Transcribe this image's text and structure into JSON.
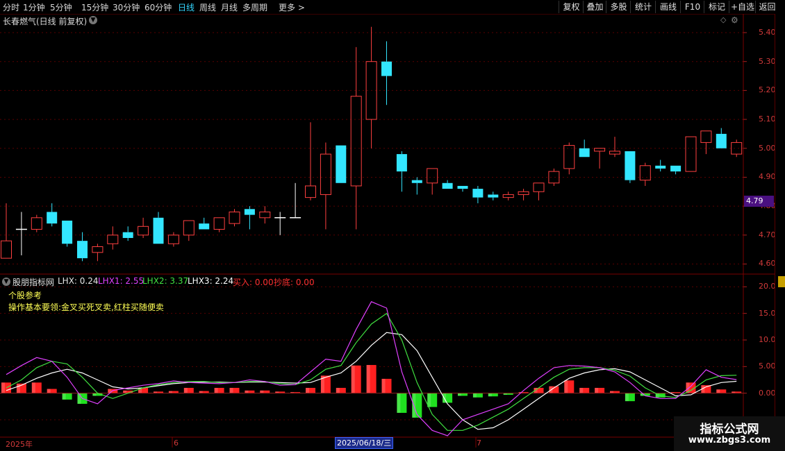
{
  "toolbar": {
    "periods": [
      "分时",
      "1分钟",
      "5分钟",
      "15分钟",
      "30分钟",
      "60分钟",
      "日线",
      "周线",
      "月线",
      "多周期",
      "更多 >"
    ],
    "active_period": "日线",
    "right_buttons": [
      "复权",
      "叠加",
      "多股",
      "统计",
      "画线",
      "F10",
      "标记",
      "+自选",
      "返回"
    ]
  },
  "main_panel": {
    "title": "长春燃气(日线 前复权)",
    "price_marker": "4.79",
    "y_labels": [
      "5.40",
      "5.30",
      "5.20",
      "5.10",
      "5.00",
      "4.90",
      "4.80",
      "4.70",
      "4.60"
    ]
  },
  "indicator_panel": {
    "name": "股朋指标网",
    "readouts": [
      {
        "text": "LHX: 0.24",
        "color": "#e6e6e6"
      },
      {
        "text": "LHX1: 2.55",
        "color": "#e040ff"
      },
      {
        "text": "LHX2: 3.37",
        "color": "#40e040"
      },
      {
        "text": "LHX3: 2.24",
        "color": "#ffffff"
      },
      {
        "text": "买入: 0.00",
        "color": "#ff3030"
      },
      {
        "text": "抄底: 0.00",
        "color": "#ff3030"
      }
    ],
    "note1": "个股参考",
    "note2": "操作基本要领:金叉买死叉卖,红柱买随便卖",
    "y_labels": [
      "20.00",
      "15.00",
      "10.00",
      "5.00",
      "0.00",
      "-5.00"
    ]
  },
  "x_axis": {
    "labels": [
      "2025年",
      "6",
      "7"
    ],
    "cursor_date": "2025/06/18/三"
  },
  "watermark": {
    "title": "指标公式网",
    "url": "www.zbgs3.com"
  },
  "colors": {
    "up": "#ff4040",
    "down": "#33e6ff",
    "grid": "#5a0000",
    "lhx1": "#e040ff",
    "lhx2": "#40e040",
    "lhx3": "#ffffff"
  },
  "chart_data": {
    "type": "candlestick",
    "ylim": [
      4.57,
      5.46
    ],
    "candles": [
      {
        "o": 4.62,
        "h": 4.81,
        "l": 4.62,
        "c": 4.68
      },
      {
        "o": 4.72,
        "h": 4.78,
        "l": 4.63,
        "c": 4.72
      },
      {
        "o": 4.72,
        "h": 4.77,
        "l": 4.71,
        "c": 4.76
      },
      {
        "o": 4.78,
        "h": 4.81,
        "l": 4.73,
        "c": 4.74
      },
      {
        "o": 4.75,
        "h": 4.75,
        "l": 4.66,
        "c": 4.67
      },
      {
        "o": 4.68,
        "h": 4.71,
        "l": 4.61,
        "c": 4.62
      },
      {
        "o": 4.64,
        "h": 4.67,
        "l": 4.61,
        "c": 4.66
      },
      {
        "o": 4.67,
        "h": 4.73,
        "l": 4.65,
        "c": 4.7
      },
      {
        "o": 4.71,
        "h": 4.73,
        "l": 4.68,
        "c": 4.69
      },
      {
        "o": 4.7,
        "h": 4.76,
        "l": 4.69,
        "c": 4.73
      },
      {
        "o": 4.76,
        "h": 4.78,
        "l": 4.67,
        "c": 4.67
      },
      {
        "o": 4.67,
        "h": 4.71,
        "l": 4.66,
        "c": 4.7
      },
      {
        "o": 4.7,
        "h": 4.75,
        "l": 4.68,
        "c": 4.75
      },
      {
        "o": 4.74,
        "h": 4.76,
        "l": 4.72,
        "c": 4.72
      },
      {
        "o": 4.72,
        "h": 4.76,
        "l": 4.71,
        "c": 4.76
      },
      {
        "o": 4.74,
        "h": 4.79,
        "l": 4.73,
        "c": 4.78
      },
      {
        "o": 4.79,
        "h": 4.8,
        "l": 4.72,
        "c": 4.77
      },
      {
        "o": 4.76,
        "h": 4.8,
        "l": 4.74,
        "c": 4.78
      },
      {
        "o": 4.76,
        "h": 4.78,
        "l": 4.7,
        "c": 4.76
      },
      {
        "o": 4.76,
        "h": 4.88,
        "l": 4.76,
        "c": 4.76
      },
      {
        "o": 4.83,
        "h": 5.09,
        "l": 4.82,
        "c": 4.87
      },
      {
        "o": 4.84,
        "h": 5.02,
        "l": 4.72,
        "c": 4.98
      },
      {
        "o": 5.01,
        "h": 5.01,
        "l": 4.88,
        "c": 4.88
      },
      {
        "o": 4.87,
        "h": 5.35,
        "l": 4.72,
        "c": 5.18
      },
      {
        "o": 5.1,
        "h": 5.42,
        "l": 5.0,
        "c": 5.3
      },
      {
        "o": 5.3,
        "h": 5.37,
        "l": 5.15,
        "c": 5.25
      },
      {
        "o": 4.98,
        "h": 4.99,
        "l": 4.85,
        "c": 4.92
      },
      {
        "o": 4.89,
        "h": 4.9,
        "l": 4.84,
        "c": 4.88
      },
      {
        "o": 4.88,
        "h": 4.93,
        "l": 4.84,
        "c": 4.93
      },
      {
        "o": 4.88,
        "h": 4.89,
        "l": 4.86,
        "c": 4.86
      },
      {
        "o": 4.87,
        "h": 4.87,
        "l": 4.85,
        "c": 4.86
      },
      {
        "o": 4.86,
        "h": 4.87,
        "l": 4.81,
        "c": 4.83
      },
      {
        "o": 4.84,
        "h": 4.85,
        "l": 4.82,
        "c": 4.83
      },
      {
        "o": 4.83,
        "h": 4.85,
        "l": 4.82,
        "c": 4.84
      },
      {
        "o": 4.84,
        "h": 4.86,
        "l": 4.82,
        "c": 4.85
      },
      {
        "o": 4.85,
        "h": 4.88,
        "l": 4.82,
        "c": 4.88
      },
      {
        "o": 4.88,
        "h": 4.93,
        "l": 4.87,
        "c": 4.92
      },
      {
        "o": 4.93,
        "h": 5.02,
        "l": 4.91,
        "c": 5.01
      },
      {
        "o": 5.0,
        "h": 5.03,
        "l": 4.97,
        "c": 4.97
      },
      {
        "o": 4.99,
        "h": 5.0,
        "l": 4.93,
        "c": 5.0
      },
      {
        "o": 4.98,
        "h": 5.04,
        "l": 4.97,
        "c": 4.99
      },
      {
        "o": 4.99,
        "h": 4.99,
        "l": 4.88,
        "c": 4.89
      },
      {
        "o": 4.89,
        "h": 4.95,
        "l": 4.87,
        "c": 4.94
      },
      {
        "o": 4.94,
        "h": 4.96,
        "l": 4.92,
        "c": 4.93
      },
      {
        "o": 4.94,
        "h": 4.94,
        "l": 4.91,
        "c": 4.92
      },
      {
        "o": 4.92,
        "h": 5.04,
        "l": 4.92,
        "c": 5.04
      },
      {
        "o": 5.02,
        "h": 5.06,
        "l": 4.98,
        "c": 5.06
      },
      {
        "o": 5.05,
        "h": 5.07,
        "l": 5.0,
        "c": 5.0
      },
      {
        "o": 4.98,
        "h": 5.03,
        "l": 4.97,
        "c": 5.02
      }
    ],
    "indicator": {
      "ylim": [
        -8,
        22
      ],
      "hist": [
        2.0,
        1.8,
        2.0,
        0.8,
        -1.2,
        -2.0,
        -0.5,
        0.8,
        0.5,
        1.0,
        0.3,
        0.4,
        1.0,
        0.4,
        1.0,
        1.0,
        0.5,
        0.5,
        0.3,
        0.2,
        1.0,
        3.3,
        1.0,
        5.2,
        5.3,
        2.7,
        -3.7,
        -4.6,
        -2.6,
        -1.8,
        -0.5,
        -0.8,
        -0.6,
        -0.3,
        0.2,
        1.0,
        1.3,
        2.4,
        1.0,
        1.0,
        0.4,
        -1.5,
        -0.5,
        -0.8,
        0.2,
        2.0,
        1.5,
        0.7,
        0.3
      ],
      "lhx1": [
        3.5,
        5.2,
        6.7,
        6.0,
        3.0,
        -1.0,
        -2.0,
        0.5,
        1.0,
        1.5,
        1.8,
        2.3,
        2.0,
        1.9,
        1.8,
        2.0,
        2.5,
        2.2,
        1.5,
        1.6,
        4.0,
        6.4,
        6.0,
        12.0,
        17.2,
        16.0,
        4.0,
        -4.0,
        -7.0,
        -8.0,
        -5.0,
        -4.0,
        -3.0,
        -2.0,
        0.5,
        2.8,
        4.8,
        5.2,
        5.1,
        4.8,
        4.0,
        2.0,
        -0.5,
        -1.0,
        -1.0,
        1.3,
        4.4,
        3.0,
        2.55
      ],
      "lhx2": [
        1.0,
        2.5,
        4.8,
        6.0,
        5.5,
        3.0,
        0.0,
        -1.0,
        0.0,
        1.0,
        1.6,
        2.0,
        2.2,
        2.2,
        2.0,
        2.0,
        2.2,
        2.2,
        1.8,
        1.6,
        2.5,
        4.5,
        5.2,
        9.5,
        13.0,
        15.0,
        10.0,
        2.0,
        -4.0,
        -7.0,
        -7.0,
        -6.0,
        -4.5,
        -3.0,
        -1.0,
        1.0,
        3.0,
        4.5,
        4.8,
        4.8,
        4.3,
        3.2,
        1.0,
        -0.5,
        -0.8,
        0.5,
        2.5,
        3.3,
        3.37
      ],
      "lhx3": [
        0.5,
        1.5,
        2.8,
        3.8,
        4.5,
        3.8,
        2.5,
        1.2,
        0.8,
        1.0,
        1.4,
        1.8,
        2.0,
        2.1,
        2.1,
        2.0,
        2.1,
        2.1,
        2.0,
        1.9,
        2.0,
        3.0,
        3.8,
        6.0,
        9.0,
        11.4,
        11.0,
        8.0,
        3.0,
        -2.0,
        -5.0,
        -6.8,
        -6.5,
        -5.0,
        -3.0,
        -1.0,
        1.0,
        2.8,
        3.8,
        4.4,
        4.6,
        4.0,
        2.5,
        1.0,
        -0.5,
        -0.3,
        1.2,
        2.0,
        2.24
      ]
    }
  }
}
